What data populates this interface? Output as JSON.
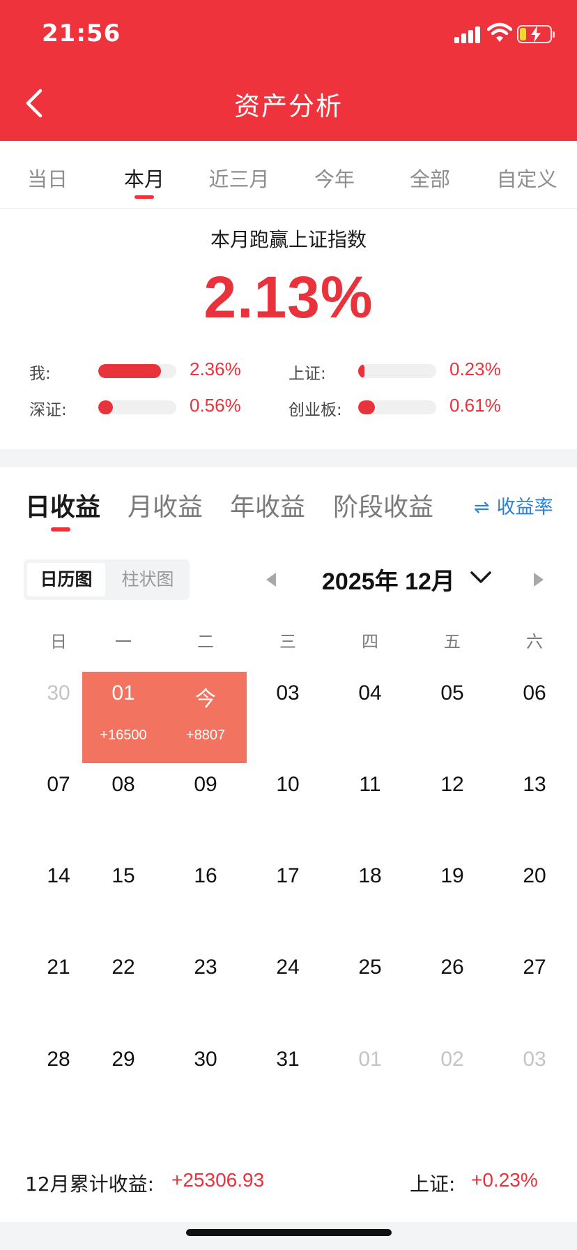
{
  "status_bar": {
    "time": "21:56"
  },
  "header": {
    "title": "资产分析"
  },
  "period_tabs": [
    {
      "label": "当日"
    },
    {
      "label": "本月",
      "active": true
    },
    {
      "label": "近三月"
    },
    {
      "label": "今年"
    },
    {
      "label": "全部"
    },
    {
      "label": "自定义"
    }
  ],
  "summary": {
    "title": "本月跑赢上证指数",
    "value": "2.13%",
    "comparisons": [
      {
        "label": "我:",
        "value": "2.36%",
        "level_pct": 80
      },
      {
        "label": "上证:",
        "value": "0.23%",
        "level_pct": 8
      },
      {
        "label": "深证:",
        "value": "0.56%",
        "level_pct": 19
      },
      {
        "label": "创业板:",
        "value": "0.61%",
        "level_pct": 21
      }
    ]
  },
  "earnings_tabs": [
    {
      "label": "日收益",
      "active": true
    },
    {
      "label": "月收益"
    },
    {
      "label": "年收益"
    },
    {
      "label": "阶段收益"
    }
  ],
  "rate_link": {
    "icon": "swap-icon",
    "label": "收益率"
  },
  "view_toggle": {
    "options": [
      "日历图",
      "柱状图"
    ],
    "selected": "日历图"
  },
  "month_selector": {
    "label": "2025年 12月"
  },
  "calendar": {
    "weekdays": [
      "日",
      "一",
      "二",
      "三",
      "四",
      "五",
      "六"
    ],
    "weeks": [
      [
        {
          "d": "30",
          "muted": true
        },
        {
          "d": "01",
          "amt": "+16500"
        },
        {
          "d": "今",
          "amt": "+8807"
        },
        {
          "d": "03"
        },
        {
          "d": "04"
        },
        {
          "d": "05"
        },
        {
          "d": "06"
        }
      ],
      [
        {
          "d": "07"
        },
        {
          "d": "08"
        },
        {
          "d": "09"
        },
        {
          "d": "10"
        },
        {
          "d": "11"
        },
        {
          "d": "12"
        },
        {
          "d": "13"
        }
      ],
      [
        {
          "d": "14"
        },
        {
          "d": "15"
        },
        {
          "d": "16"
        },
        {
          "d": "17"
        },
        {
          "d": "18"
        },
        {
          "d": "19"
        },
        {
          "d": "20"
        }
      ],
      [
        {
          "d": "21"
        },
        {
          "d": "22"
        },
        {
          "d": "23"
        },
        {
          "d": "24"
        },
        {
          "d": "25"
        },
        {
          "d": "26"
        },
        {
          "d": "27"
        }
      ],
      [
        {
          "d": "28"
        },
        {
          "d": "29"
        },
        {
          "d": "30"
        },
        {
          "d": "31"
        },
        {
          "d": "01",
          "muted": true
        },
        {
          "d": "02",
          "muted": true
        },
        {
          "d": "03",
          "muted": true
        }
      ]
    ]
  },
  "footer": {
    "label": "12月累计收益:",
    "value": "+25306.93",
    "index_label": "上证:",
    "index_value": "+0.23%"
  },
  "colors": {
    "brand_red": "#ee333c",
    "profit_cell": "#f2735f",
    "link_blue": "#2a7fd8"
  }
}
